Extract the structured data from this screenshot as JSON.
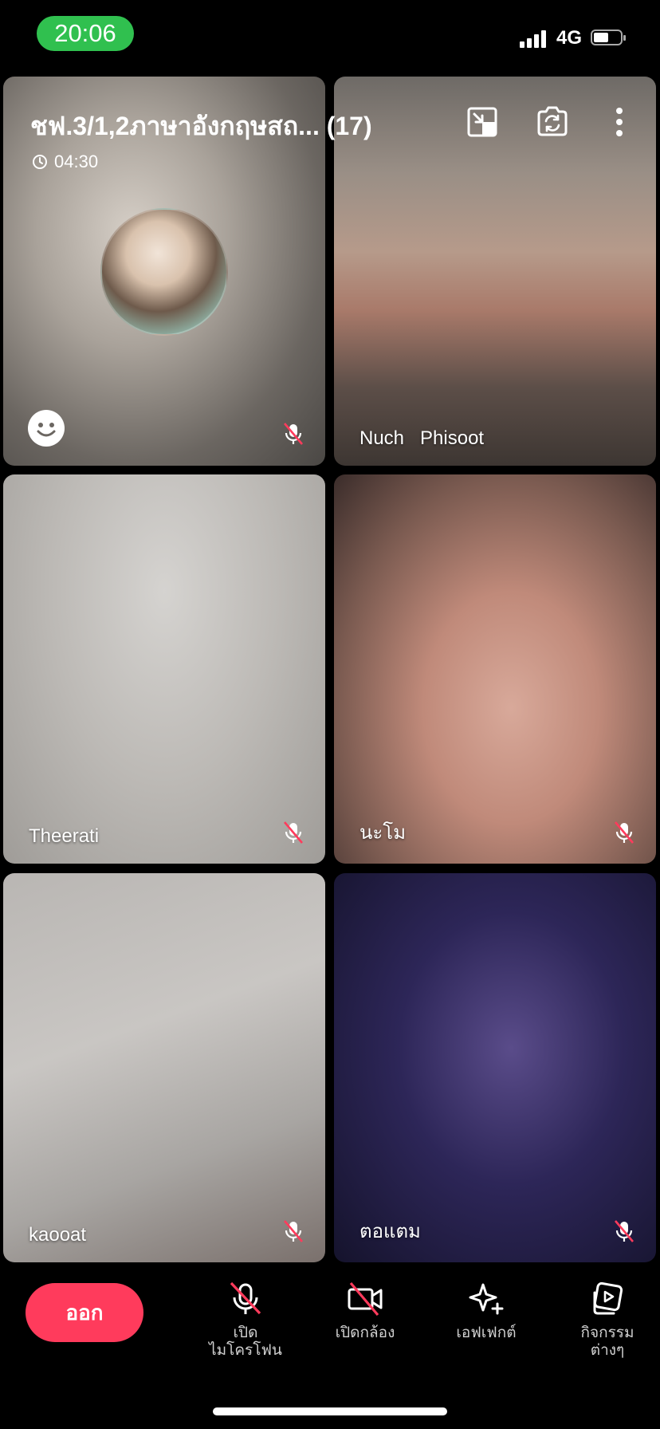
{
  "status_bar": {
    "time": "20:06",
    "network": "4G",
    "time_pill_color": "#30c04f"
  },
  "call": {
    "title": "ชฟ.3/1,2ภาษาอังกฤษสถ... (17)",
    "duration": "04:30"
  },
  "participants": [
    {
      "name": "",
      "muted": true
    },
    {
      "name": "Nuch   Phisoot",
      "muted": false
    },
    {
      "name": "Theerati",
      "muted": true
    },
    {
      "name": "นะโม",
      "muted": true
    },
    {
      "name": "kaooat",
      "muted": true
    },
    {
      "name": "ตอแตม",
      "muted": true
    }
  ],
  "top_icons": [
    "picture-in-picture-icon",
    "flip-camera-icon",
    "more-vertical-icon"
  ],
  "bottom_bar": {
    "leave_label": "ออก",
    "leave_color": "#ff3b5c",
    "mic_label_1": "เปิด",
    "mic_label_2": "ไมโครโฟน",
    "camera_label": "เปิดกล้อง",
    "effects_label": "เอฟเฟกต์",
    "activities_label_1": "กิจกรรม",
    "activities_label_2": "ต่างๆ"
  }
}
